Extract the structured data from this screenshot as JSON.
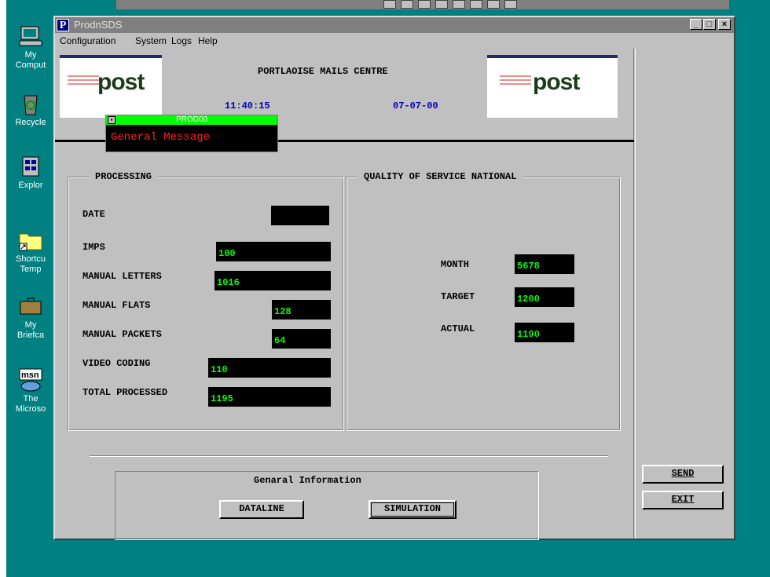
{
  "window": {
    "title": "ProdnSDS",
    "app_icon_letter": "P",
    "min_glyph": "_",
    "max_glyph": "□",
    "close_glyph": "×"
  },
  "menu": [
    "Configuration",
    "System",
    "Logs",
    "Help"
  ],
  "header": {
    "centre_name": "PORTLAOISE MAILS CENTRE",
    "time": "11:40:15",
    "date": "07-07-00",
    "logo_text": "post"
  },
  "popup": {
    "title": "PROD00",
    "sys_glyph": "▪",
    "message": "General Message"
  },
  "processing": {
    "title": "PROCESSING",
    "fields": [
      {
        "label": "DATE",
        "value": ""
      },
      {
        "label": "IMPS",
        "value": "100"
      },
      {
        "label": "MANUAL LETTERS",
        "value": "1016"
      },
      {
        "label": "MANUAL FLATS",
        "value": "128"
      },
      {
        "label": "MANUAL PACKETS",
        "value": "64"
      },
      {
        "label": "VIDEO CODING",
        "value": "110"
      },
      {
        "label": "TOTAL PROCESSED",
        "value": "1195"
      }
    ]
  },
  "quality": {
    "title": "QUALITY OF SERVICE NATIONAL",
    "fields": [
      {
        "label": "MONTH",
        "value": "5678"
      },
      {
        "label": "TARGET",
        "value": "1200"
      },
      {
        "label": "ACTUAL",
        "value": "1190"
      }
    ]
  },
  "info": {
    "title": "Genaral Information",
    "dataline_label": "DATALINE",
    "simulation_label": "SIMULATION"
  },
  "actions": {
    "send_label": "SEND",
    "exit_label": "EXIT"
  },
  "desktop_icons": [
    {
      "label1": "My",
      "label2": "Comput",
      "icon": "computer-icon"
    },
    {
      "label1": "Recycle",
      "label2": "",
      "icon": "recycle-bin-icon"
    },
    {
      "label1": "Explor",
      "label2": "",
      "icon": "explorer-icon"
    },
    {
      "label1": "Shortcu",
      "label2": "Temp",
      "icon": "folder-shortcut-icon"
    },
    {
      "label1": "My",
      "label2": "Briefca",
      "icon": "briefcase-icon"
    },
    {
      "label1": "The",
      "label2": "Microso",
      "icon": "msn-icon"
    }
  ],
  "colors": {
    "desktop": "#008080",
    "value_text": "#00ff00",
    "clock_text": "#0000c0",
    "popup_message": "#ff2020"
  }
}
